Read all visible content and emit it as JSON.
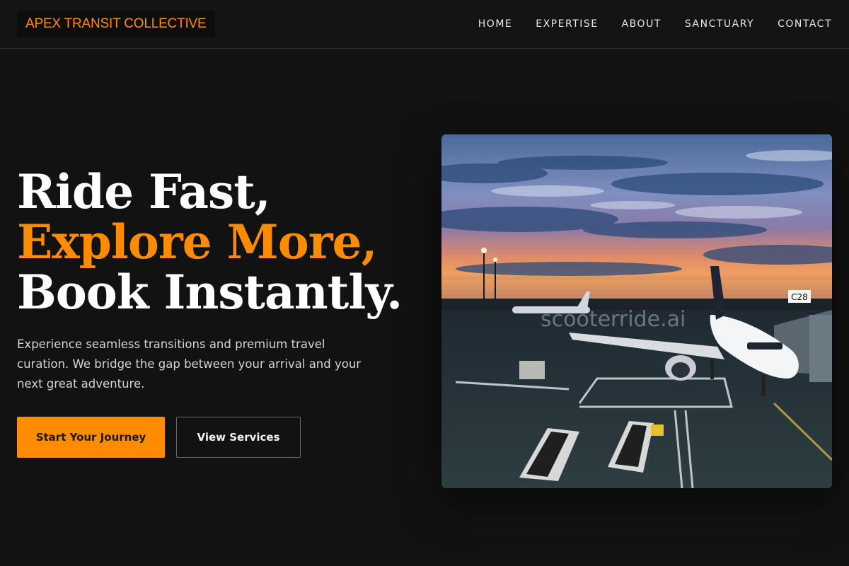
{
  "colors": {
    "accent": "#ff8c00",
    "background": "#121212",
    "header_bg": "#141414",
    "text_primary": "#ffffff",
    "text_muted": "#d4d4d4"
  },
  "header": {
    "brand": "APEX TRANSIT COLLECTIVE",
    "nav": [
      "HOME",
      "EXPERTISE",
      "ABOUT",
      "SANCTUARY",
      "CONTACT"
    ]
  },
  "hero": {
    "headline": {
      "line1": "Ride Fast,",
      "line2": "Explore More,",
      "line3": "Book Instantly."
    },
    "description": "Experience seamless transitions and premium travel curation. We bridge the gap between your arrival and your next great adventure.",
    "primary_cta": "Start Your Journey",
    "secondary_cta": "View Services",
    "image": {
      "gate_sign": "C28",
      "watermark": "scooterride.ai"
    }
  }
}
